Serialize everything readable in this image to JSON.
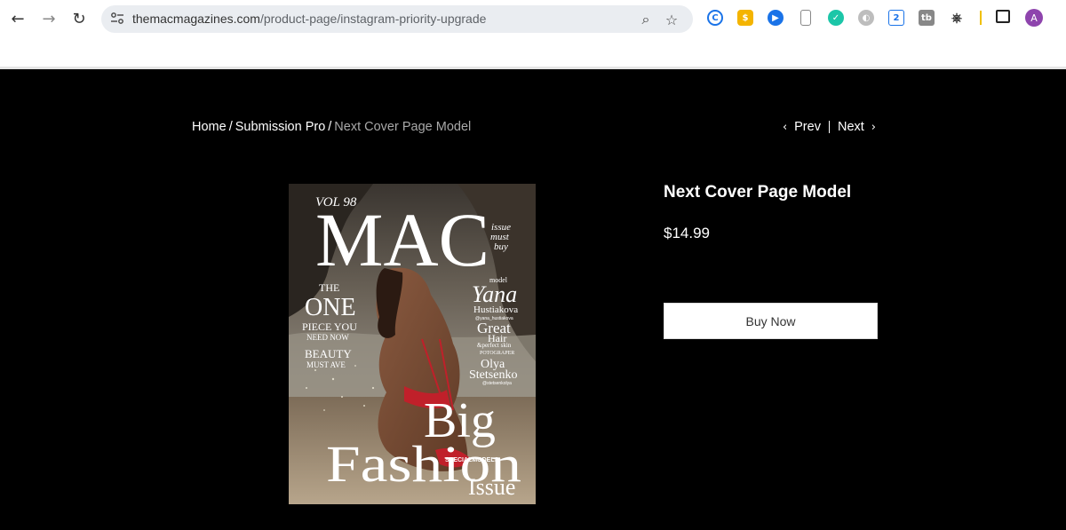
{
  "browser": {
    "url_domain": "themacmagazines.com",
    "url_path": "/product-page/instagram-priority-upgrade",
    "avatar_initial": "A"
  },
  "breadcrumb": {
    "home": "Home",
    "category": "Submission Pro",
    "current": "Next Cover Page Model"
  },
  "pager": {
    "prev": "Prev",
    "next": "Next"
  },
  "product": {
    "title": "Next Cover Page Model",
    "price": "$14.99",
    "buy_label": "Buy Now"
  },
  "cover": {
    "vol": "VOL 98",
    "masthead": "MAC",
    "side_issue": [
      "issue",
      "must",
      "buy"
    ],
    "left_lines": [
      "THE",
      "ONE",
      "PIECE YOU",
      "NEED NOW",
      "BEAUTY",
      "MUST AVE"
    ],
    "model_label": "model",
    "model_first": "Yana",
    "model_last": "Hustiakova",
    "model_handle": "@yana_hustiakova",
    "great": "Great",
    "hair": "Hair",
    "skin": "&perfect skin",
    "photographer_label": "POTOGRAPER",
    "photog_first": "Olya",
    "photog_last": "Stetsenko",
    "photog_handle": "@stetsenkolya",
    "big": "Big",
    "fashion": "Fashion",
    "special": "SPECIALMODELS",
    "issue": "Issue"
  },
  "colors": {
    "page_bg": "#000000",
    "breadcrumb_current": "#a9a9a9",
    "swimsuit": "#c0202a"
  }
}
